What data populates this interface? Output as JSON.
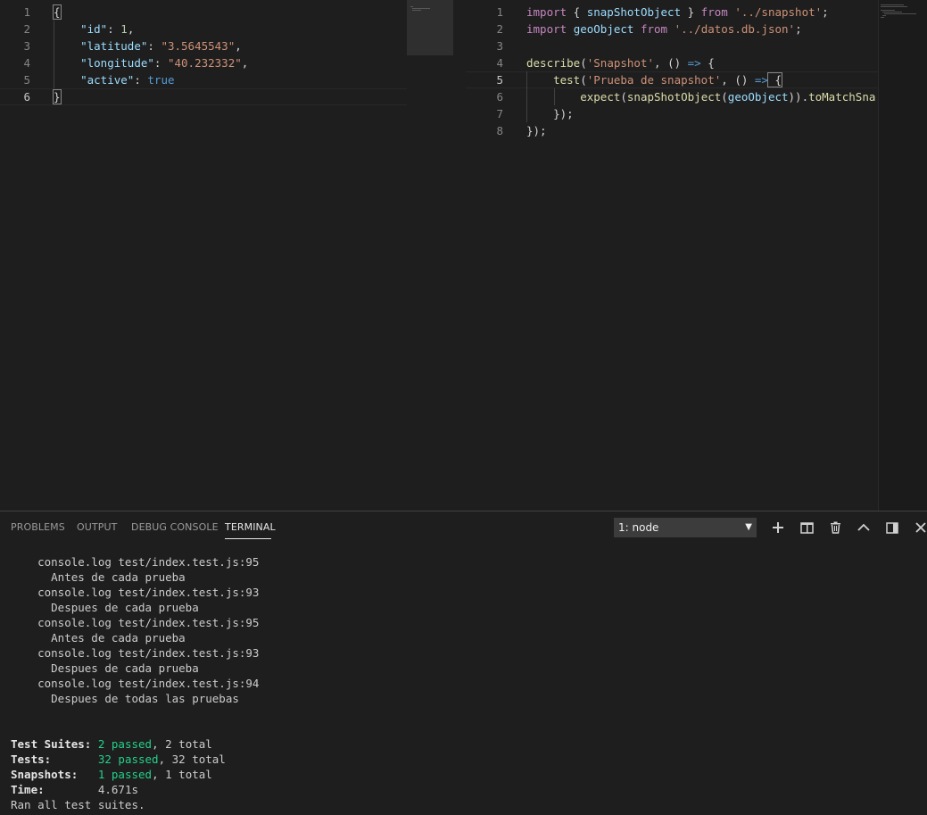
{
  "left_editor": {
    "line_numbers": [
      "1",
      "2",
      "3",
      "4",
      "5",
      "6"
    ],
    "lines": {
      "l1_brace": "{",
      "l2_key": "\"id\"",
      "l2_sep": ": ",
      "l2_val": "1",
      "l2_end": ",",
      "l3_key": "\"latitude\"",
      "l3_sep": ": ",
      "l3_val": "\"3.5645543\"",
      "l3_end": ",",
      "l4_key": "\"longitude\"",
      "l4_sep": ": ",
      "l4_val": "\"40.232332\"",
      "l4_end": ",",
      "l5_key": "\"active\"",
      "l5_sep": ": ",
      "l5_val": "true",
      "l6_brace": "}"
    },
    "active_line": "6"
  },
  "right_editor": {
    "line_numbers": [
      "1",
      "2",
      "3",
      "4",
      "5",
      "6",
      "7",
      "8"
    ],
    "lines": {
      "l1_kw1": "import",
      "l1_a": " { ",
      "l1_var": "snapShotObject",
      "l1_b": " } ",
      "l1_kw2": "from",
      "l1_sp": " ",
      "l1_str": "'../snapshot'",
      "l1_end": ";",
      "l2_kw1": "import",
      "l2_sp1": " ",
      "l2_var": "geoObject",
      "l2_sp2": " ",
      "l2_kw2": "from",
      "l2_sp3": " ",
      "l2_str": "'../datos.db.json'",
      "l2_end": ";",
      "l4_fn": "describe",
      "l4_a": "(",
      "l4_str": "'Snapshot'",
      "l4_b": ", () ",
      "l4_arrow": "=>",
      "l4_c": " {",
      "l5_fn": "test",
      "l5_a": "(",
      "l5_str": "'Prueba de snapshot'",
      "l5_b": ", () ",
      "l5_arrow": "=>",
      "l5_c": " {",
      "l6_fn1": "expect",
      "l6_a": "(",
      "l6_fn2": "snapShotObject",
      "l6_b": "(",
      "l6_var": "geoObject",
      "l6_c": ")).",
      "l6_fn3": "toMatchSna",
      "l7": "});",
      "l8": "});"
    },
    "active_line": "5"
  },
  "panel": {
    "tabs": [
      "PROBLEMS",
      "OUTPUT",
      "DEBUG CONSOLE",
      "TERMINAL"
    ],
    "active_tab": "TERMINAL",
    "terminal_select": "1: node",
    "icons": [
      "add-icon",
      "split-icon",
      "trash-icon",
      "chevron-up-icon",
      "maximize-icon",
      "close-icon"
    ]
  },
  "terminal": {
    "log_lines": [
      "    console.log test/index.test.js:95",
      "      Antes de cada prueba",
      "    console.log test/index.test.js:93",
      "      Despues de cada prueba",
      "    console.log test/index.test.js:95",
      "      Antes de cada prueba",
      "    console.log test/index.test.js:93",
      "      Despues de cada prueba",
      "    console.log test/index.test.js:94",
      "      Despues de todas las pruebas"
    ],
    "summary": {
      "suites_label": "Test Suites:",
      "suites_pad": " ",
      "suites_passed": "2 passed",
      "suites_rest": ", 2 total",
      "tests_label": "Tests:",
      "tests_pad": "       ",
      "tests_passed": "32 passed",
      "tests_rest": ", 32 total",
      "snapshots_label": "Snapshots:",
      "snapshots_pad": "   ",
      "snapshots_passed": "1 passed",
      "snapshots_rest": ", 1 total",
      "time_label": "Time:",
      "time_pad": "        ",
      "time_value": "4.671s",
      "ran_all": "Ran all test suites."
    }
  },
  "colors": {
    "background": "#1e1e1e",
    "key": "#9cdcfe",
    "string": "#ce9178",
    "keyword": "#c586c0",
    "function": "#dcdcaa",
    "boolean": "#569cd6",
    "terminal_green": "#23d18b"
  }
}
